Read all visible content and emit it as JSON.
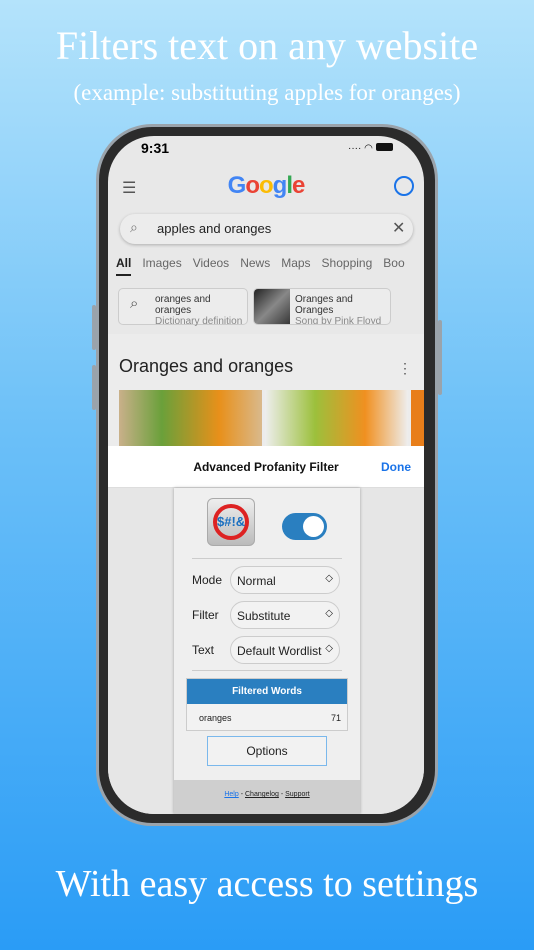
{
  "promo": {
    "headline": "Filters text on any website",
    "subheadline": "(example: substituting apples for oranges)",
    "footer": "With easy access to settings"
  },
  "status_bar": {
    "time": "9:31"
  },
  "google": {
    "logo": "Google",
    "search_value": "apples and oranges",
    "tabs": [
      "All",
      "Images",
      "Videos",
      "News",
      "Maps",
      "Shopping",
      "Boo"
    ],
    "cards": [
      {
        "title": "oranges and oranges",
        "subtitle": "Dictionary definition"
      },
      {
        "title": "Oranges and Oranges",
        "subtitle": "Song by Pink Floyd"
      }
    ],
    "section_title": "Oranges and oranges"
  },
  "sheet": {
    "title": "Advanced Profanity Filter",
    "done": "Done"
  },
  "panel": {
    "enabled": true,
    "accent": "#2a7fc0",
    "mode_label": "Mode",
    "mode_value": "Normal",
    "filter_label": "Filter",
    "filter_value": "Substitute",
    "text_label": "Text",
    "text_value": "Default Wordlist",
    "filtered_header": "Filtered Words",
    "filtered_words": [
      {
        "word": "oranges",
        "count": "71"
      }
    ],
    "options": "Options",
    "help": "Help",
    "changelog": "Changelog",
    "support": "Support",
    "sep": "-"
  }
}
